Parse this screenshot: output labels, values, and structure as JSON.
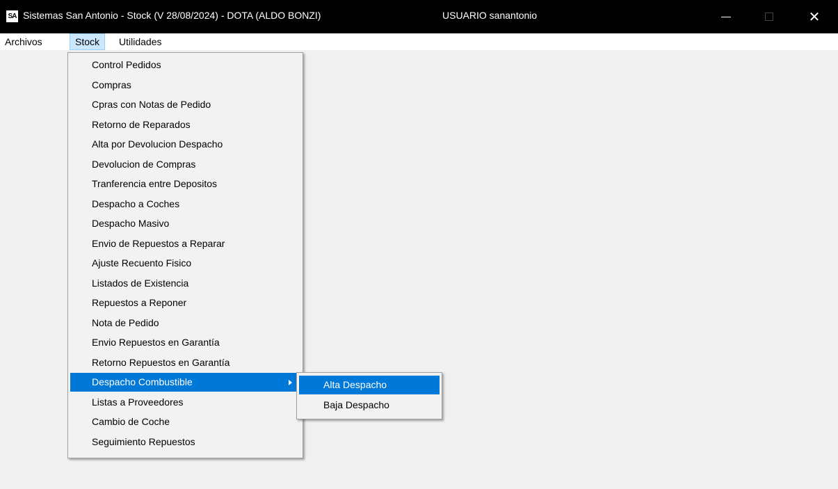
{
  "window": {
    "title": "Sistemas San Antonio - Stock (V 28/08/2024) - DOTA (ALDO BONZI)",
    "user": "USUARIO sanantonio",
    "app_icon": "SA",
    "close_glyph": "✕"
  },
  "menubar": {
    "items": [
      "Archivos",
      "Stock",
      "Utilidades"
    ]
  },
  "stock_menu": {
    "items": [
      "Control Pedidos",
      "Compras",
      "Cpras con Notas de Pedido",
      "Retorno de Reparados",
      "Alta por Devolucion Despacho",
      "Devolucion de Compras",
      "Tranferencia entre Depositos",
      "Despacho a Coches",
      "Despacho Masivo",
      "Envio de Repuestos a Reparar",
      "Ajuste Recuento Fisico",
      "Listados de Existencia",
      "Repuestos a Reponer",
      "Nota de Pedido",
      "Envio Repuestos en Garantía",
      "Retorno Repuestos en Garantía",
      "Despacho Combustible",
      "Listas a Proveedores",
      "Cambio de Coche",
      "Seguimiento Repuestos"
    ]
  },
  "submenu": {
    "items": [
      "Alta Despacho",
      "Baja Despacho"
    ]
  },
  "colors": {
    "highlight": "#0078d7",
    "menubar_selected": "#cce8ff"
  }
}
